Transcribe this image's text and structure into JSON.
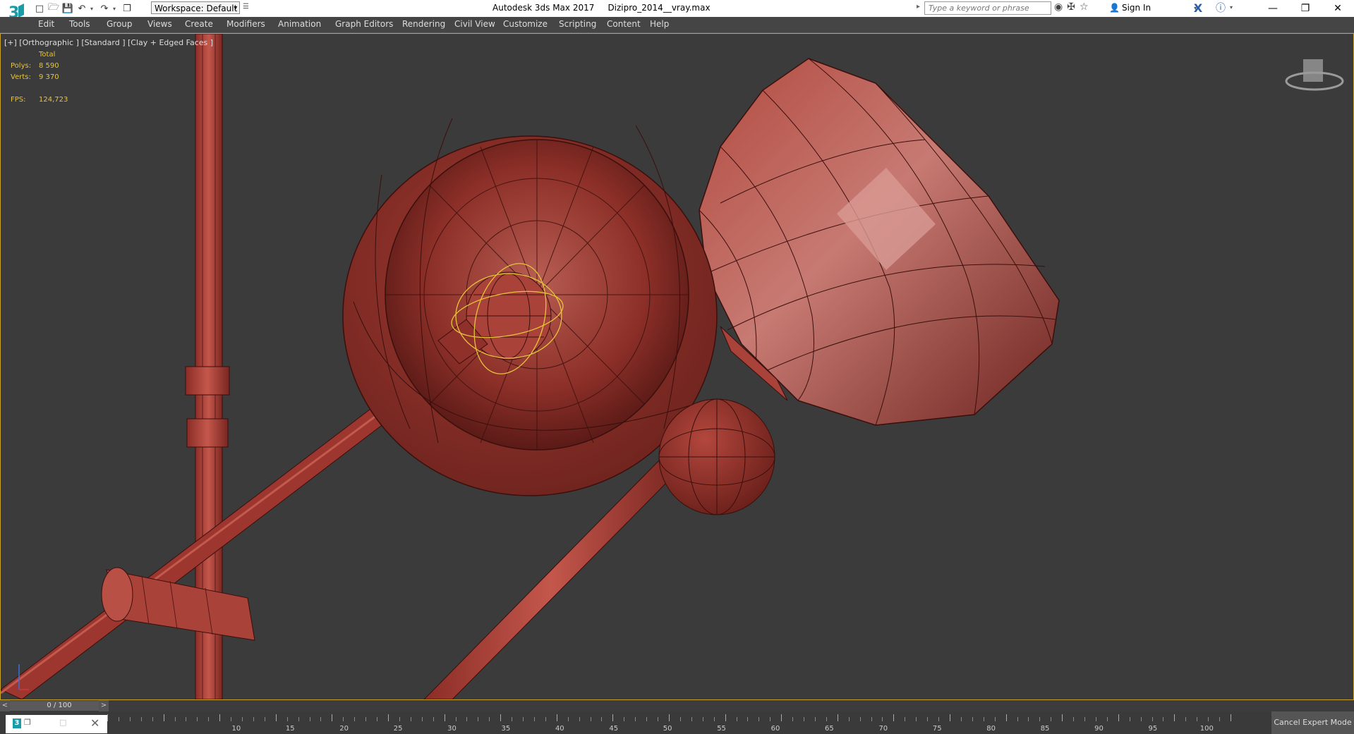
{
  "titlebar": {
    "app_title": "Autodesk 3ds Max 2017",
    "file_name": "Dizipro_2014__vray.max",
    "workspace": "Workspace: Default",
    "search_placeholder": "Type a keyword or phrase",
    "sign_in": "Sign In"
  },
  "menu": {
    "items": [
      "Edit",
      "Tools",
      "Group",
      "Views",
      "Create",
      "Modifiers",
      "Animation",
      "Graph Editors",
      "Rendering",
      "Civil View",
      "Customize",
      "Scripting",
      "Content",
      "Help"
    ]
  },
  "viewport": {
    "label": "[+] [Orthographic ] [Standard ] [Clay + Edged Faces ]",
    "stats": {
      "header": "Total",
      "polys_label": "Polys:",
      "polys": "8 590",
      "verts_label": "Verts:",
      "verts": "9 370",
      "fps_label": "FPS:",
      "fps": "124,723"
    }
  },
  "timeline": {
    "slider_label": "0 / 100",
    "left_arrow": "<",
    "right_arrow": ">",
    "ruler_labels": [
      "10",
      "15",
      "20",
      "25",
      "30",
      "35",
      "40",
      "45",
      "50",
      "55",
      "60",
      "65",
      "70",
      "75",
      "80",
      "85",
      "90",
      "95",
      "100"
    ],
    "cancel_expert": "Cancel Expert Mode"
  },
  "colors": {
    "clay_light": "#c25a4e",
    "clay_mid": "#9e3c33",
    "clay_dark": "#6e2420",
    "selection": "#e6c43a",
    "viewport_bg": "#3b3b3b"
  }
}
